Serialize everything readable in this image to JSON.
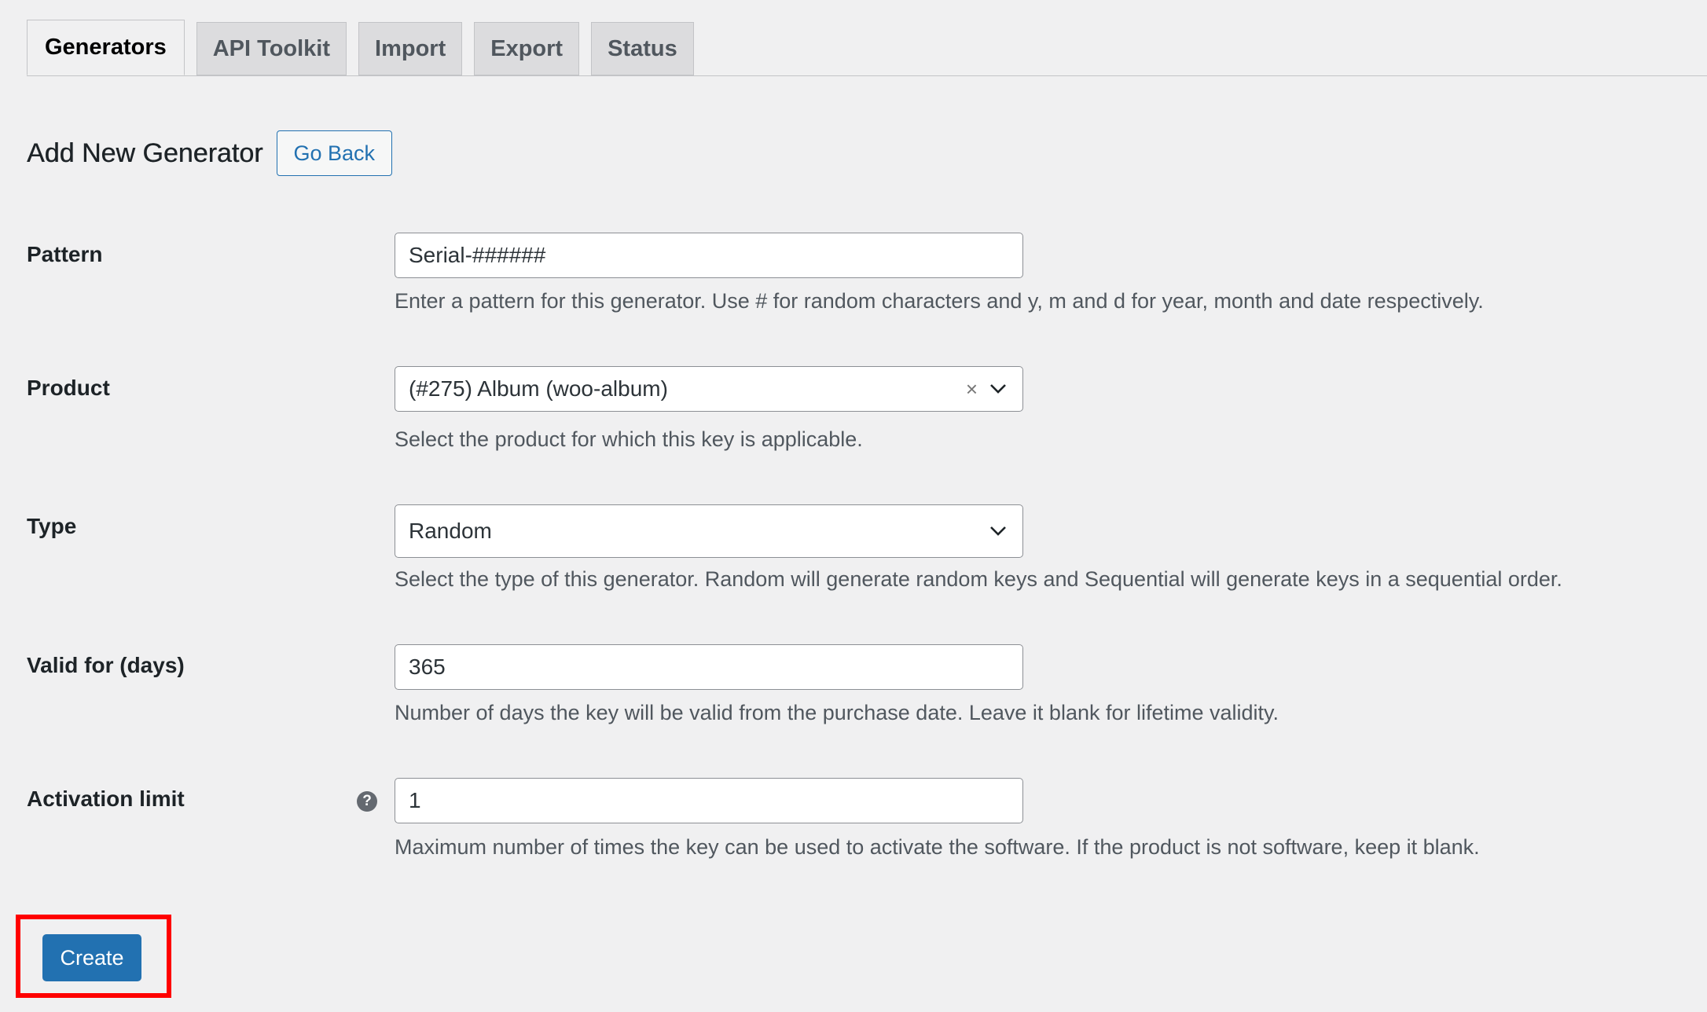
{
  "tabs": [
    {
      "label": "Generators",
      "active": true
    },
    {
      "label": "API Toolkit",
      "active": false
    },
    {
      "label": "Import",
      "active": false
    },
    {
      "label": "Export",
      "active": false
    },
    {
      "label": "Status",
      "active": false
    }
  ],
  "heading": {
    "title": "Add New Generator",
    "go_back_label": "Go Back"
  },
  "form": {
    "pattern": {
      "label": "Pattern",
      "value": "Serial-######",
      "description": "Enter a pattern for this generator. Use # for random characters and y, m and d for year, month and date respectively."
    },
    "product": {
      "label": "Product",
      "value": "(#275) Album (woo-album)",
      "clear_glyph": "×",
      "description": "Select the product for which this key is applicable."
    },
    "type": {
      "label": "Type",
      "value": "Random",
      "description": "Select the type of this generator. Random will generate random keys and Sequential will generate keys in a sequential order."
    },
    "valid_for": {
      "label": "Valid for (days)",
      "value": "365",
      "description": "Number of days the key will be valid from the purchase date. Leave it blank for lifetime validity."
    },
    "activation_limit": {
      "label": "Activation limit",
      "help_glyph": "?",
      "value": "1",
      "description": "Maximum number of times the key can be used to activate the software. If the product is not software, keep it blank."
    }
  },
  "actions": {
    "create_label": "Create"
  },
  "colors": {
    "accent": "#2271b1",
    "highlight": "#ff0000",
    "background": "#f0f0f1"
  }
}
